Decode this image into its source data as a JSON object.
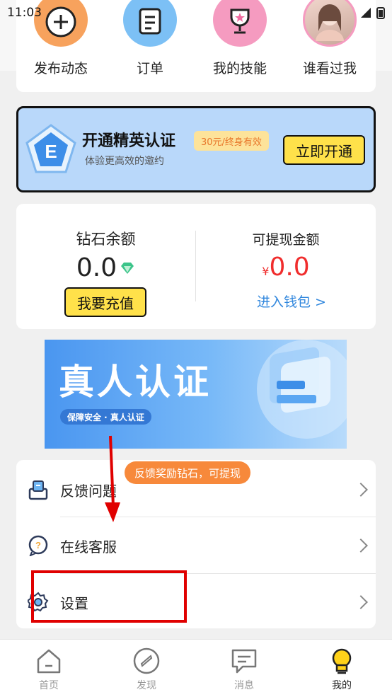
{
  "status_bar": {
    "time": "11:03"
  },
  "quick_actions": [
    {
      "label": "发布动态",
      "icon": "plus-circle-icon"
    },
    {
      "label": "订单",
      "icon": "document-icon"
    },
    {
      "label": "我的技能",
      "icon": "trophy-icon"
    },
    {
      "label": "谁看过我",
      "icon": "avatar-image"
    }
  ],
  "elite": {
    "badge_letter": "E",
    "title": "开通精英认证",
    "subtitle": "体验更高效的邀约",
    "tag": "30元/终身有效",
    "button": "立即开通"
  },
  "wallet": {
    "diamond_label": "钻石余额",
    "diamond_value": "0.0",
    "recharge_button": "我要充值",
    "cash_label": "可提现金额",
    "cash_currency": "¥",
    "cash_value": "0.0",
    "wallet_link": "进入钱包 >"
  },
  "verify_banner": {
    "title": "真人认证",
    "subtitle": "保障安全 · 真人认证"
  },
  "menu": {
    "reward_bubble": "反馈奖励钻石，可提现",
    "items": [
      {
        "label": "反馈问题",
        "icon": "feedback-icon"
      },
      {
        "label": "在线客服",
        "icon": "customer-service-icon"
      },
      {
        "label": "设置",
        "icon": "gear-icon"
      }
    ]
  },
  "bottom_nav": [
    {
      "label": "首页",
      "icon": "home-icon"
    },
    {
      "label": "发现",
      "icon": "compass-icon"
    },
    {
      "label": "消息",
      "icon": "message-icon"
    },
    {
      "label": "我的",
      "icon": "profile-bulb-icon",
      "active": true
    }
  ],
  "colors": {
    "accent_yellow": "#ffe14a",
    "annotation_red": "#e00000",
    "link_blue": "#2f86dd",
    "cash_red": "#f02d2d"
  }
}
